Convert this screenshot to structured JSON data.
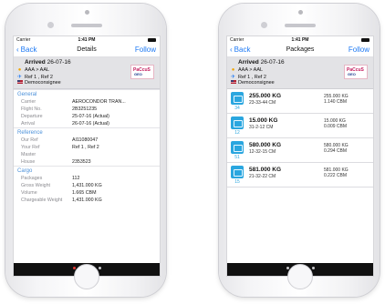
{
  "status": {
    "carrier": "Carrier",
    "time": "1:41 PM"
  },
  "details": {
    "nav": {
      "back": "Back",
      "title": "Details",
      "follow": "Follow"
    },
    "header": {
      "arrived_label": "Arrived",
      "arrived_date": "26-07-16",
      "route": "AAA > AAL",
      "refs": "Ref 1 , Ref 2",
      "consignee": "Democonsignee",
      "logo_top": "PaCcuS",
      "logo_bottom": "GEO"
    },
    "sections": [
      {
        "title": "General",
        "rows": [
          {
            "label": "Carrier",
            "value": "AEROCONDOR TRAN..."
          },
          {
            "label": "Flight No.",
            "value": "2B3251235"
          },
          {
            "label": "Departure",
            "value": "25-07-16 (Actual)"
          },
          {
            "label": "Arrival",
            "value": "26-07-16 (Actual)"
          }
        ]
      },
      {
        "title": "Reference",
        "rows": [
          {
            "label": "Our Ref",
            "value": "AI11080047"
          },
          {
            "label": "Your Ref",
            "value": "Ref 1 , Ref 2"
          },
          {
            "label": "Master",
            "value": ""
          },
          {
            "label": "House",
            "value": "2353523"
          }
        ]
      },
      {
        "title": "Cargo",
        "rows": [
          {
            "label": "Packages",
            "value": "112"
          },
          {
            "label": "Gross Weight",
            "value": "1,431.000 KG"
          },
          {
            "label": "Volume",
            "value": "1.665 CBM"
          },
          {
            "label": "Chargeable Weight",
            "value": "1,431.000 KG"
          }
        ]
      }
    ],
    "pager": {
      "count": 5,
      "active": 0
    }
  },
  "packages": {
    "nav": {
      "back": "Back",
      "title": "Packages",
      "follow": "Follow"
    },
    "header": {
      "arrived_label": "Arrived",
      "arrived_date": "26-07-16",
      "route": "AAA > AAL",
      "refs": "Ref 1 , Ref 2",
      "consignee": "Democonsignee",
      "logo_top": "PaCcuS",
      "logo_bottom": "GEO"
    },
    "items": [
      {
        "count": "34",
        "weight": "255.000 KG",
        "dims": "23-33-44 CM",
        "weight2": "255.000 KG",
        "volume": "1.140 CBM"
      },
      {
        "count": "12",
        "weight": "15.000 KG",
        "dims": "31-2-12 CM",
        "weight2": "15.000 KG",
        "volume": "0.009 CBM"
      },
      {
        "count": "51",
        "weight": "580.000 KG",
        "dims": "12-32-15 CM",
        "weight2": "580.000 KG",
        "volume": "0.294 CBM"
      },
      {
        "count": "15",
        "weight": "581.000 KG",
        "dims": "21-32-22 CM",
        "weight2": "581.000 KG",
        "volume": "0.222 CBM"
      }
    ],
    "pager": {
      "count": 5,
      "active": 2
    }
  },
  "icons": {
    "back": "chevron-left-icon",
    "route": "location-pin-icon",
    "refs": "airplane-icon",
    "consignee": "us-flag-icon",
    "package": "package-box-icon"
  }
}
